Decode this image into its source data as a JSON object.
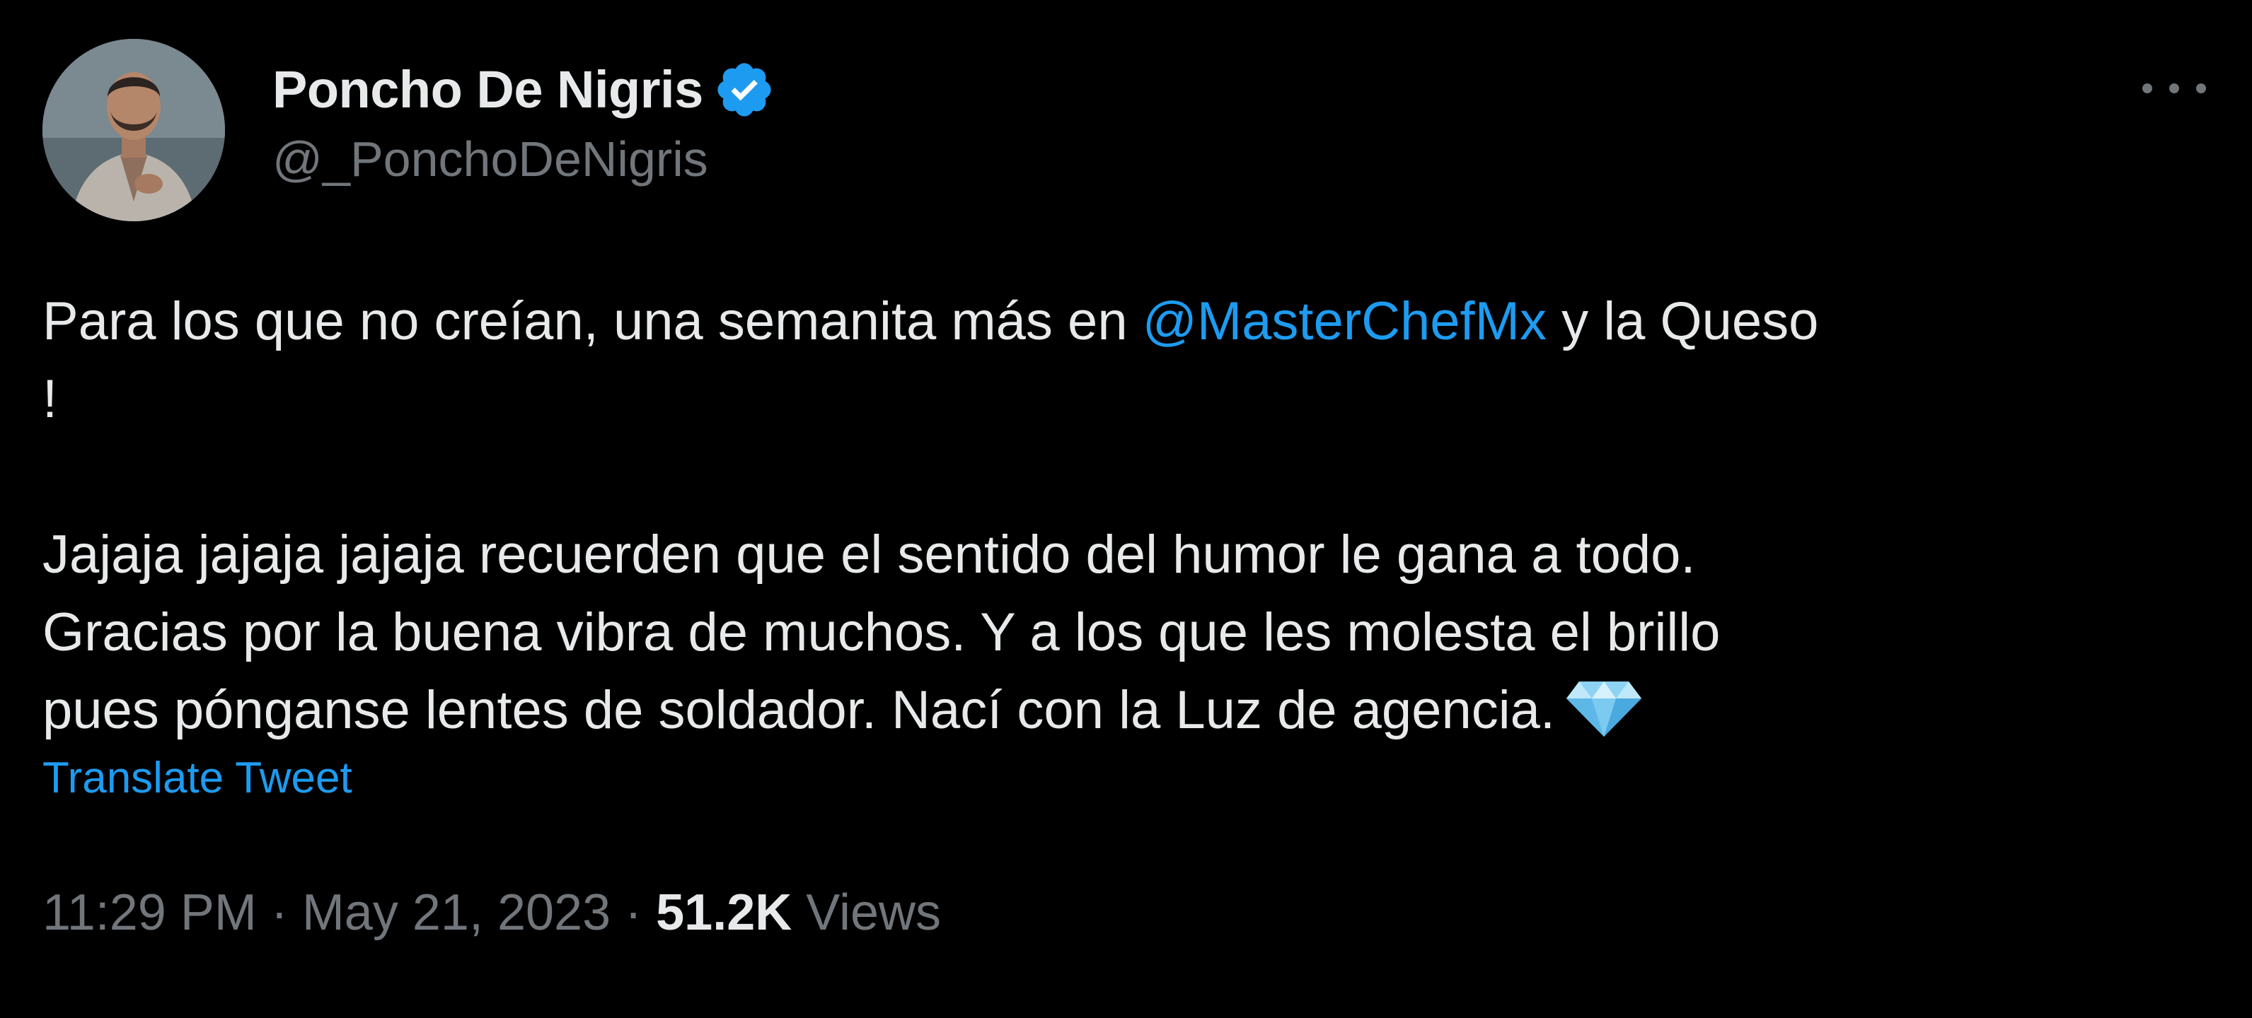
{
  "author": {
    "display_name": "Poncho De Nigris",
    "handle": "@_PonchoDeNigris",
    "verified": true,
    "verified_icon": "verified-badge-icon",
    "avatar": "avatar-photo"
  },
  "tweet": {
    "line1_pre": "Para los que no creían, una semanita más en ",
    "mention": "@MasterChefMx",
    "line1_post": " y la Queso",
    "line2": "!",
    "para2_line1": "Jajaja jajaja jajaja recuerden que el sentido del humor le gana a todo.",
    "para2_line2": "Gracias por la buena vibra de muchos. Y a los que les molesta el brillo",
    "para2_line3": "pues pónganse lentes de soldador. Nací con la Luz de agencia.",
    "emoji": "gem-stone-emoji",
    "translate_label": "Translate Tweet"
  },
  "meta": {
    "time": "11:29 PM",
    "separator1": " · ",
    "date": "May 21, 2023",
    "separator2": " · ",
    "views_count": "51.2K",
    "views_label": " Views"
  },
  "icons": {
    "more": "more-options-icon"
  },
  "colors": {
    "background": "#000000",
    "text": "#e7e9ea",
    "secondary": "#71767b",
    "link": "#1d9bf0"
  }
}
